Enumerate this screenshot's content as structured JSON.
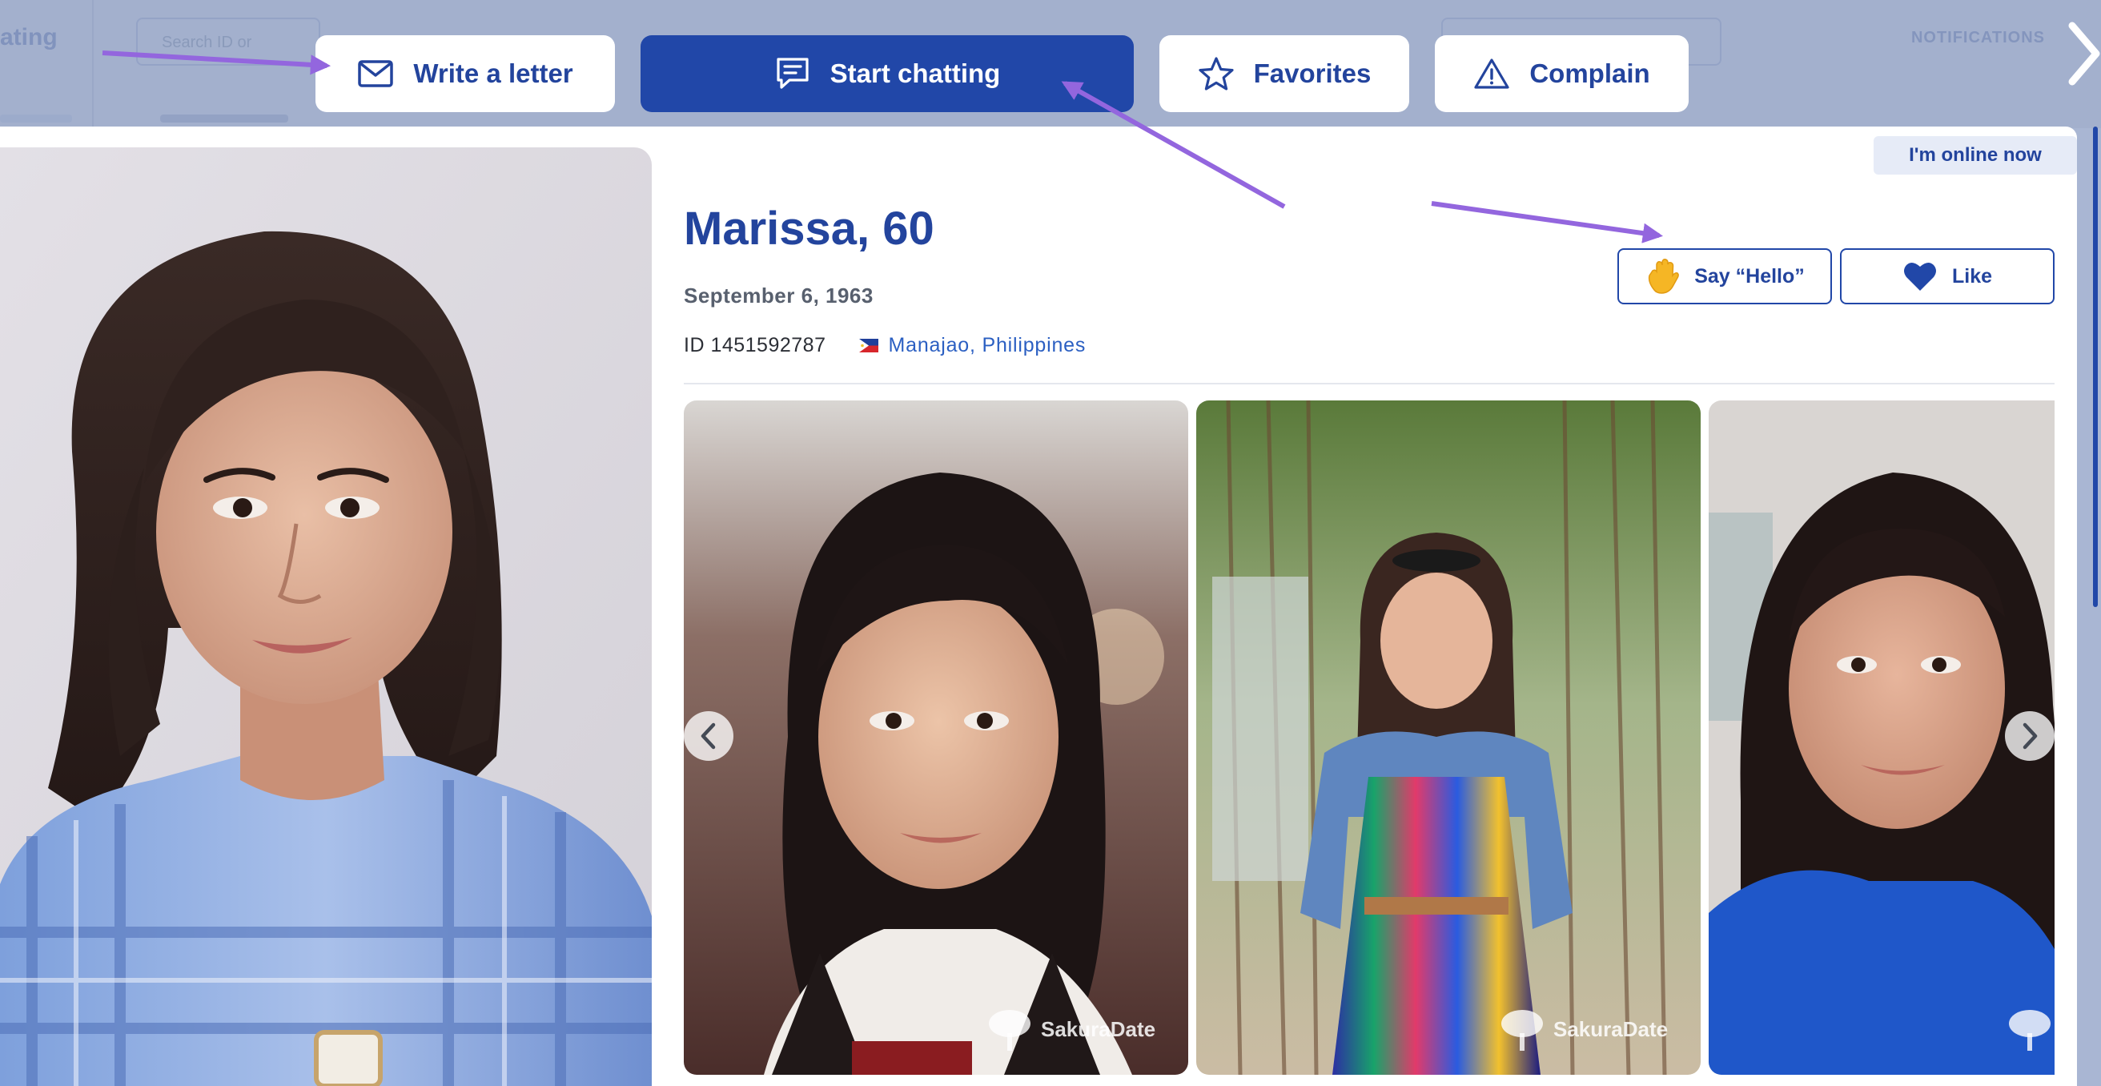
{
  "background_header": {
    "logo_text": "ating",
    "search_placeholder": "Search ID or",
    "notifications_label": "NOTIFICATIONS"
  },
  "top_actions": {
    "write_letter": "Write a letter",
    "start_chatting": "Start chatting",
    "favorites": "Favorites",
    "complain": "Complain"
  },
  "profile": {
    "online_status": "I'm online now",
    "name_age": "Marissa, 60",
    "birth_date": "September 6, 1963",
    "id_text": "ID 1451592787",
    "location": "Manajao, Philippines",
    "say_hello": "Say “Hello”",
    "like": "Like"
  },
  "gallery": {
    "watermark": "SakuraDate"
  },
  "colors": {
    "brand_blue": "#2147a8",
    "link_blue": "#2b5fc2",
    "annotation_purple": "#9366de",
    "backdrop": "#a9b6d3"
  },
  "icons": [
    "envelope-icon",
    "chat-bubble-icon",
    "star-icon",
    "warning-triangle-icon",
    "waving-hand-icon",
    "heart-icon",
    "philippines-flag-icon",
    "chevron-left-icon",
    "chevron-right-icon",
    "sakura-tree-icon"
  ]
}
